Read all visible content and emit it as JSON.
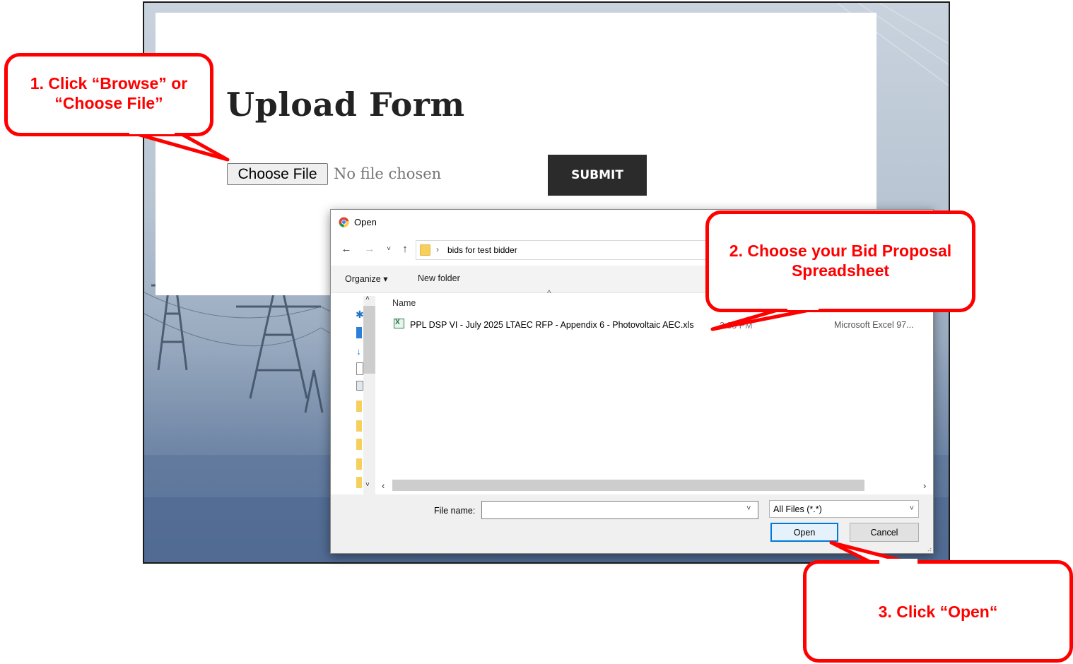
{
  "upload_form": {
    "title": "Upload Form",
    "choose_file_label": "Choose File",
    "no_file_text": "No file chosen",
    "submit_label": "SUBMIT"
  },
  "dialog": {
    "title": "Open",
    "nav": {
      "back_icon": "arrow-left-icon",
      "forward_icon": "arrow-right-icon",
      "recent_icon": "chevron-down-icon",
      "up_icon": "arrow-up-icon",
      "separator": "›",
      "path": "bids for test bidder"
    },
    "toolbar": {
      "organize_label": "Organize ▾",
      "new_folder_label": "New folder"
    },
    "file_list": {
      "column_name": "Name",
      "sort_caret": "^",
      "files": [
        {
          "name": "PPL DSP VI - July 2025 LTAEC RFP - Appendix 6 - Photovoltaic AEC.xls",
          "date_visible": "2:05 PM",
          "type": "Microsoft Excel 97..."
        }
      ]
    },
    "scroll": {
      "left": "‹",
      "right": "›",
      "up": "˄",
      "down": "˅"
    },
    "filename_label": "File name:",
    "filename_value": "",
    "filename_dropdown": "˅",
    "filetype_value": "All Files (*.*)",
    "filetype_caret": "˅",
    "open_label": "Open",
    "cancel_label": "Cancel"
  },
  "callouts": [
    {
      "text": "1. Click “Browse” or “Choose File”"
    },
    {
      "text": "2. Choose your Bid Proposal Spreadsheet"
    },
    {
      "text": "3. Click “Open“"
    }
  ],
  "colors": {
    "callout_red": "#ff0000",
    "submit_dark": "#2b2b2b",
    "open_accent": "#0078d7"
  }
}
